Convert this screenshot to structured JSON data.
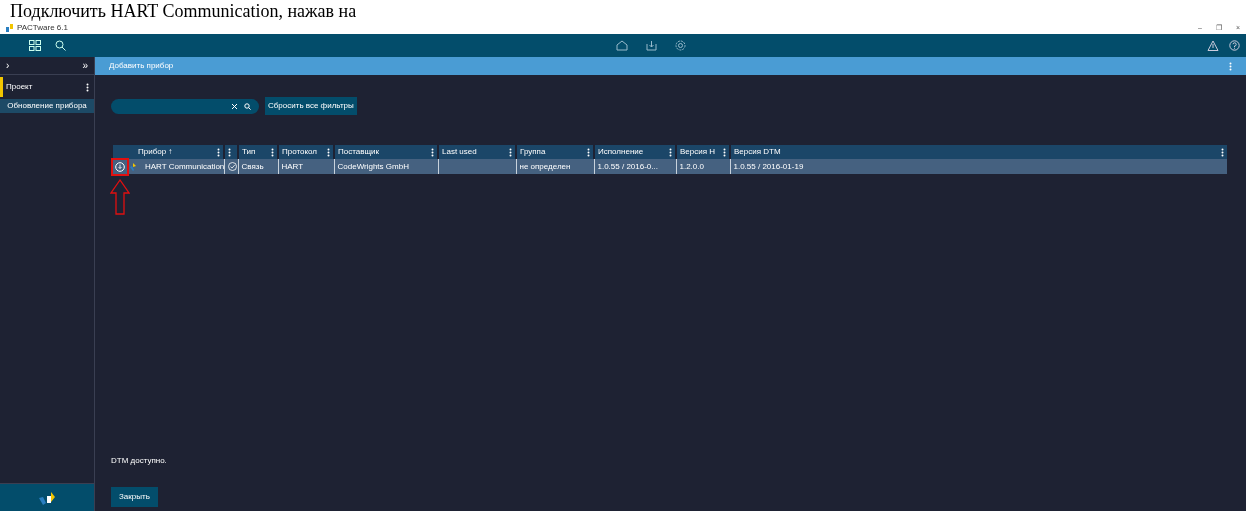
{
  "document_text": "Подключить HART Communication, нажав на",
  "window": {
    "title": "PACTware 6.1",
    "controls": [
      "–",
      "❐",
      "×"
    ]
  },
  "sidebar": {
    "nav": [
      "›",
      "»"
    ],
    "project": "Проект",
    "items": [
      {
        "label": "Обновление прибора",
        "selected": true
      }
    ]
  },
  "panel_title": "Добавить прибор",
  "reset_button": "Сбросить все фильтры",
  "table": {
    "columns": [
      {
        "kind": "text",
        "label": "Прибор ↑"
      },
      {
        "kind": "status"
      },
      {
        "kind": "text",
        "label": "Тип"
      },
      {
        "kind": "text",
        "label": "Протокол"
      },
      {
        "kind": "text",
        "label": "Поставщик"
      },
      {
        "kind": "text",
        "label": "Last used"
      },
      {
        "kind": "text",
        "label": "Группа"
      },
      {
        "kind": "text",
        "label": "Исполнение"
      },
      {
        "kind": "text",
        "label": "Версия Н"
      },
      {
        "kind": "text",
        "label": "Версия DTM"
      }
    ],
    "rows": [
      {
        "selected": true,
        "available": true,
        "cells": [
          "HART Communication",
          "",
          "Связь",
          "HART",
          "CodeWrights GmbH",
          "",
          "не определен",
          "1.0.55 / 2016-0...",
          "1.2.0.0",
          "1.0.55 / 2016-01-19"
        ]
      }
    ]
  },
  "status_message": "DTM доступно.",
  "close_button": "Закрыть"
}
